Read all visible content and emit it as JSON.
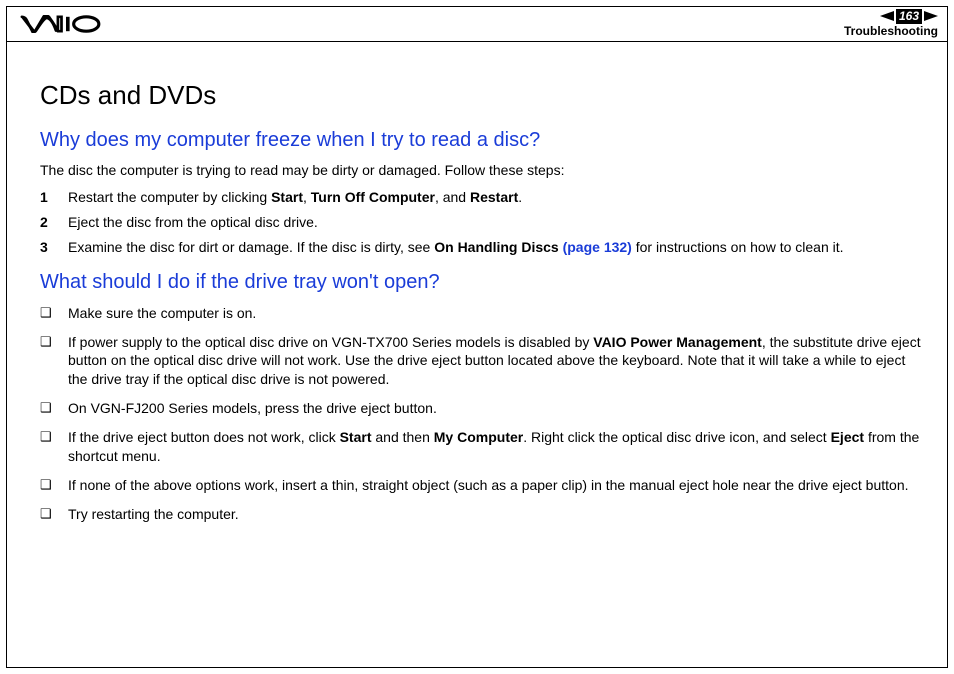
{
  "header": {
    "page_number": "163",
    "section": "Troubleshooting"
  },
  "title": "CDs and DVDs",
  "q1": {
    "heading": "Why does my computer freeze when I try to read a disc?",
    "intro": "The disc the computer is trying to read may be dirty or damaged. Follow these steps:",
    "steps": {
      "s1_a": "Restart the computer by clicking ",
      "s1_b": "Start",
      "s1_c": ", ",
      "s1_d": "Turn Off Computer",
      "s1_e": ", and ",
      "s1_f": "Restart",
      "s1_g": ".",
      "s2": "Eject the disc from the optical disc drive.",
      "s3_a": "Examine the disc for dirt or damage. If the disc is dirty, see ",
      "s3_b": "On Handling Discs ",
      "s3_c": "(page 132)",
      "s3_d": " for instructions on how to clean it."
    }
  },
  "q2": {
    "heading": "What should I do if the drive tray won't open?",
    "items": {
      "i1": "Make sure the computer is on.",
      "i2_a": "If power supply to the optical disc drive on VGN-TX700 Series models is disabled by ",
      "i2_b": "VAIO Power Management",
      "i2_c": ", the substitute drive eject button on the optical disc drive will not work. Use the drive eject button located above the keyboard. Note that it will take a while to eject the drive tray if the optical disc drive is not powered.",
      "i3": "On VGN-FJ200 Series models, press the drive eject button.",
      "i4_a": "If the drive eject button does not work, click ",
      "i4_b": "Start",
      "i4_c": " and then ",
      "i4_d": "My Computer",
      "i4_e": ". Right click the optical disc drive icon, and select ",
      "i4_f": "Eject",
      "i4_g": " from the shortcut menu.",
      "i5": "If none of the above options work, insert a thin, straight object (such as a paper clip) in the manual eject hole near the drive eject button.",
      "i6": "Try restarting the computer."
    }
  }
}
